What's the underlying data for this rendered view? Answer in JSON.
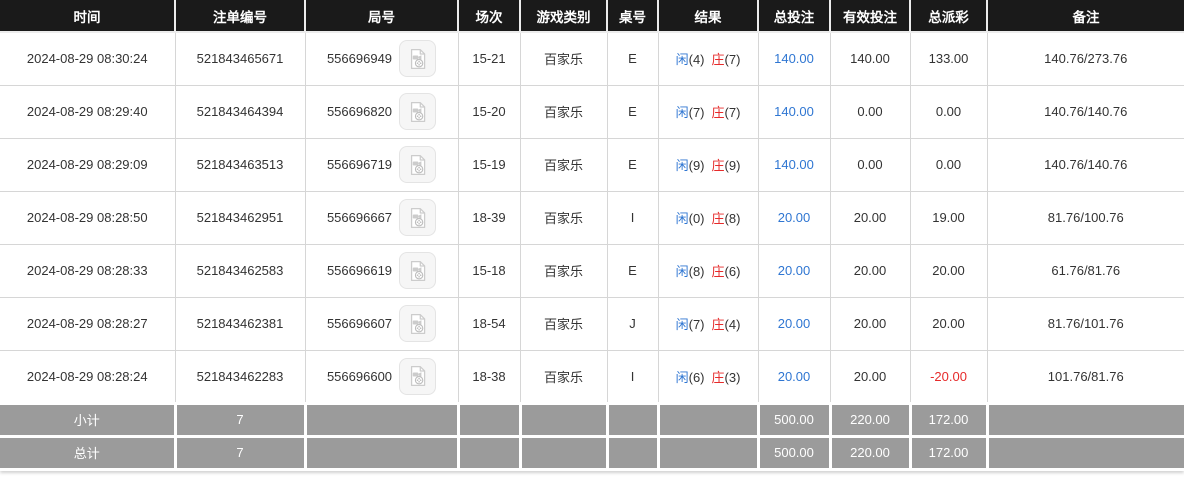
{
  "table": {
    "columns": [
      "时间",
      "注单编号",
      "局号",
      "场次",
      "游戏类别",
      "桌号",
      "结果",
      "总投注",
      "有效投注",
      "总派彩",
      "备注"
    ],
    "rows": [
      {
        "time": "2024-08-29 08:30:24",
        "bet_id": "521843465671",
        "round_id": "556696949",
        "session": "15-21",
        "game_type": "百家乐",
        "table_no": "E",
        "result": {
          "player": "闲",
          "player_value": "(4)",
          "banker": "庄",
          "banker_value": "(7)"
        },
        "total_bet": "140.00",
        "valid_bet": "140.00",
        "payout": "133.00",
        "remark": "140.76/273.76"
      },
      {
        "time": "2024-08-29 08:29:40",
        "bet_id": "521843464394",
        "round_id": "556696820",
        "session": "15-20",
        "game_type": "百家乐",
        "table_no": "E",
        "result": {
          "player": "闲",
          "player_value": "(7)",
          "banker": "庄",
          "banker_value": "(7)"
        },
        "total_bet": "140.00",
        "valid_bet": "0.00",
        "payout": "0.00",
        "remark": "140.76/140.76"
      },
      {
        "time": "2024-08-29 08:29:09",
        "bet_id": "521843463513",
        "round_id": "556696719",
        "session": "15-19",
        "game_type": "百家乐",
        "table_no": "E",
        "result": {
          "player": "闲",
          "player_value": "(9)",
          "banker": "庄",
          "banker_value": "(9)"
        },
        "total_bet": "140.00",
        "valid_bet": "0.00",
        "payout": "0.00",
        "remark": "140.76/140.76"
      },
      {
        "time": "2024-08-29 08:28:50",
        "bet_id": "521843462951",
        "round_id": "556696667",
        "session": "18-39",
        "game_type": "百家乐",
        "table_no": "I",
        "result": {
          "player": "闲",
          "player_value": "(0)",
          "banker": "庄",
          "banker_value": "(8)"
        },
        "total_bet": "20.00",
        "valid_bet": "20.00",
        "payout": "19.00",
        "remark": "81.76/100.76"
      },
      {
        "time": "2024-08-29 08:28:33",
        "bet_id": "521843462583",
        "round_id": "556696619",
        "session": "15-18",
        "game_type": "百家乐",
        "table_no": "E",
        "result": {
          "player": "闲",
          "player_value": "(8)",
          "banker": "庄",
          "banker_value": "(6)"
        },
        "total_bet": "20.00",
        "valid_bet": "20.00",
        "payout": "20.00",
        "remark": "61.76/81.76"
      },
      {
        "time": "2024-08-29 08:28:27",
        "bet_id": "521843462381",
        "round_id": "556696607",
        "session": "18-54",
        "game_type": "百家乐",
        "table_no": "J",
        "result": {
          "player": "闲",
          "player_value": "(7)",
          "banker": "庄",
          "banker_value": "(4)"
        },
        "total_bet": "20.00",
        "valid_bet": "20.00",
        "payout": "20.00",
        "remark": "81.76/101.76"
      },
      {
        "time": "2024-08-29 08:28:24",
        "bet_id": "521843462283",
        "round_id": "556696600",
        "session": "18-38",
        "game_type": "百家乐",
        "table_no": "I",
        "result": {
          "player": "闲",
          "player_value": "(6)",
          "banker": "庄",
          "banker_value": "(3)"
        },
        "total_bet": "20.00",
        "valid_bet": "20.00",
        "payout": "-20.00",
        "remark": "101.76/81.76"
      }
    ],
    "subtotal": {
      "label": "小计",
      "count": "7",
      "total_bet": "500.00",
      "valid_bet": "220.00",
      "payout": "172.00"
    },
    "total": {
      "label": "总计",
      "count": "7",
      "total_bet": "500.00",
      "valid_bet": "220.00",
      "payout": "172.00"
    }
  },
  "icons": {
    "video_replay": "video-file-icon"
  },
  "colors": {
    "header_bg": "#1a1a1a",
    "footer_bg": "#9b9b9b",
    "accent_blue": "#2f76d2",
    "accent_red": "#e62b2b",
    "body_text": "#333333",
    "border": "#d6d6d6"
  }
}
